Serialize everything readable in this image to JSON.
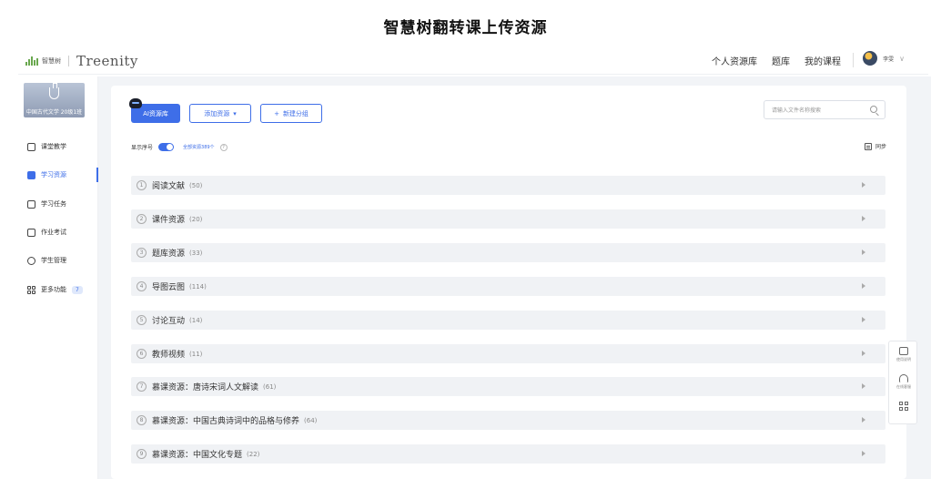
{
  "caption": "智慧树翻转课上传资源",
  "header": {
    "logo_cn": "智慧树",
    "logo_en": "Treenity",
    "nav": [
      "个人资源库",
      "题库",
      "我的课程"
    ],
    "user_name": "李雯"
  },
  "sidebar": {
    "course_name": "中国古代文学 20级1班",
    "items": [
      {
        "label": "课堂教学",
        "icon": "play-icon"
      },
      {
        "label": "学习资源",
        "icon": "document-icon",
        "active": true
      },
      {
        "label": "学习任务",
        "icon": "task-icon"
      },
      {
        "label": "作业考试",
        "icon": "exam-icon"
      },
      {
        "label": "学生管理",
        "icon": "student-icon"
      },
      {
        "label": "更多功能",
        "icon": "grid-icon",
        "badge": "7"
      }
    ]
  },
  "toolbar": {
    "ai_label": "AI资源库",
    "add_label": "添加资源",
    "new_group_label": "新建分组",
    "search_placeholder": "请输入文件名称搜索"
  },
  "options": {
    "show_index_label": "显示序号",
    "total_note": "全部资源389个",
    "sync_label": "同步"
  },
  "categories": [
    {
      "index": "1",
      "name": "阅读文献",
      "count": "(50)"
    },
    {
      "index": "2",
      "name": "课件资源",
      "count": "(20)"
    },
    {
      "index": "3",
      "name": "题库资源",
      "count": "(33)"
    },
    {
      "index": "4",
      "name": "导图云图",
      "count": "(114)"
    },
    {
      "index": "5",
      "name": "讨论互动",
      "count": "(14)"
    },
    {
      "index": "6",
      "name": "教师视频",
      "count": "(11)"
    },
    {
      "index": "7",
      "name": "慕课资源：唐诗宋词人文解读",
      "count": "(61)"
    },
    {
      "index": "8",
      "name": "慕课资源：中国古典诗词中的品格与修养",
      "count": "(64)"
    },
    {
      "index": "9",
      "name": "慕课资源：中国文化专题",
      "count": "(22)"
    }
  ],
  "side_tools": [
    "使用说明",
    "在线客服",
    ""
  ],
  "colors": {
    "accent": "#3e6ee8",
    "row_bg": "#f0f2f5",
    "main_bg": "#f2f4f7"
  }
}
